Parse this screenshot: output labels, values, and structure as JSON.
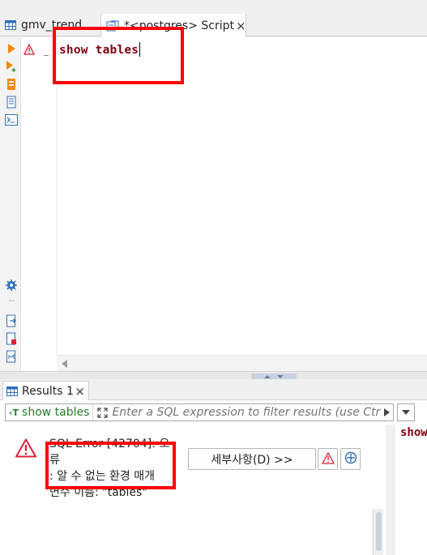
{
  "editor_tabs": [
    {
      "label": "gmv_trend",
      "icon": "table-icon"
    },
    {
      "label": "*<postgres> Script",
      "icon": "sql-script-icon",
      "close_label": "×"
    }
  ],
  "left_toolbar": {
    "icons": [
      "run-statement-icon",
      "run-script-icon",
      "explain-plan-icon",
      "open-result-icon",
      "terminal-icon",
      "settings-icon",
      "load-script-icon",
      "save-script-icon",
      "export-icon"
    ],
    "more_label": "····"
  },
  "editor": {
    "code": "show tables",
    "gutter_marker": "warning-icon"
  },
  "results": {
    "tab_label": "Results 1",
    "tab_close_label": "×",
    "filter": {
      "query_label": "show tables",
      "placeholder": "Enter a SQL expression to filter results (use Ctrl+"
    },
    "error": {
      "message_lines": [
        "SQL Error [42704]: 오류",
        ": 알 수 없는 환경 매개",
        "변수 이름: \"tables\""
      ],
      "details_button": "세부사항(D) >>"
    },
    "side_preview": "show"
  },
  "colors": {
    "keyword": "#7f0010",
    "error_red": "#d9223a",
    "highlight": "#ff0000",
    "query_green": "#2a7a2a"
  }
}
